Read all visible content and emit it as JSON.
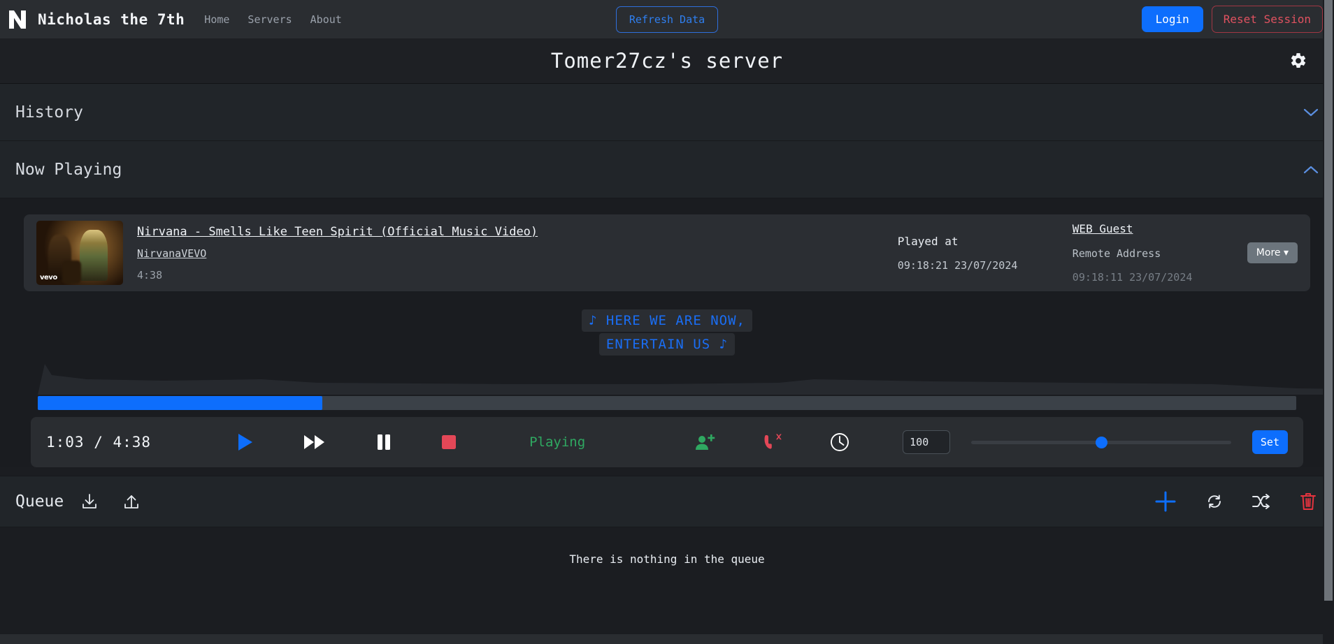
{
  "navbar": {
    "logo_icon": "letter-n-logo",
    "brand": "Nicholas the 7th",
    "links": [
      {
        "label": "Home"
      },
      {
        "label": "Servers"
      },
      {
        "label": "About"
      }
    ],
    "refresh_label": "Refresh Data",
    "login_label": "Login",
    "reset_label": "Reset Session"
  },
  "server": {
    "title": "Tomer27cz's server",
    "settings_icon": "gear-icon"
  },
  "sections": {
    "history": {
      "title": "History",
      "chevron": "chevron-down-icon",
      "expanded": false
    },
    "now_playing": {
      "title": "Now Playing",
      "chevron": "chevron-up-icon",
      "expanded": true
    }
  },
  "now_playing": {
    "thumbnail_badge": "vevo",
    "title": "Nirvana - Smells Like Teen Spirit (Official Music Video)",
    "channel": "NirvanaVEVO",
    "duration": "4:38",
    "played_at_label": "Played at",
    "played_at_value": "09:18:21 23/07/2024",
    "user_name": "WEB Guest",
    "user_address_label": "Remote Address",
    "user_time": "09:18:11 23/07/2024",
    "more_label": "More"
  },
  "lyrics": {
    "lines": [
      "♪ HERE WE ARE NOW,",
      "ENTERTAIN US ♪"
    ],
    "color": "#1a6ef5"
  },
  "progress": {
    "percent": 22.6,
    "fill_color": "#0d6efd",
    "track_color": "#3b4148"
  },
  "controls": {
    "current_time": "1:03",
    "total_time": "4:38",
    "time_display": "1:03 / 4:38",
    "buttons": [
      {
        "name": "play-icon",
        "label": "Play",
        "color": "#0d6efd"
      },
      {
        "name": "fast-forward-icon",
        "label": "Fast forward",
        "color": "#ffffff"
      },
      {
        "name": "pause-icon",
        "label": "Pause",
        "color": "#ffffff"
      },
      {
        "name": "stop-icon",
        "label": "Stop",
        "color": "#e34757"
      }
    ],
    "status": "Playing",
    "status_color": "#2fa861",
    "extra_buttons": [
      {
        "name": "person-add-icon",
        "label": "Join voice channel",
        "color": "#2fa861"
      },
      {
        "name": "phone-hangup-icon",
        "label": "Disconnect",
        "color": "#e34757"
      },
      {
        "name": "clock-icon",
        "label": "History",
        "color": "#ffffff"
      }
    ],
    "volume_value": "100",
    "volume_placeholder": "100",
    "volume_slider_percent": 50,
    "set_label": "Set"
  },
  "queue": {
    "title": "Queue",
    "left_icons": [
      {
        "name": "download-icon",
        "label": "Download queue"
      },
      {
        "name": "upload-icon",
        "label": "Upload queue"
      }
    ],
    "right_icons": [
      {
        "name": "plus-icon",
        "label": "Add to queue",
        "color": "#0d6efd"
      },
      {
        "name": "loop-icon",
        "label": "Loop queue",
        "color": "#ffffff"
      },
      {
        "name": "shuffle-icon",
        "label": "Shuffle queue",
        "color": "#ffffff"
      },
      {
        "name": "trash-icon",
        "label": "Clear queue",
        "color": "#e8343f"
      }
    ],
    "empty_message": "There is nothing in the queue"
  }
}
